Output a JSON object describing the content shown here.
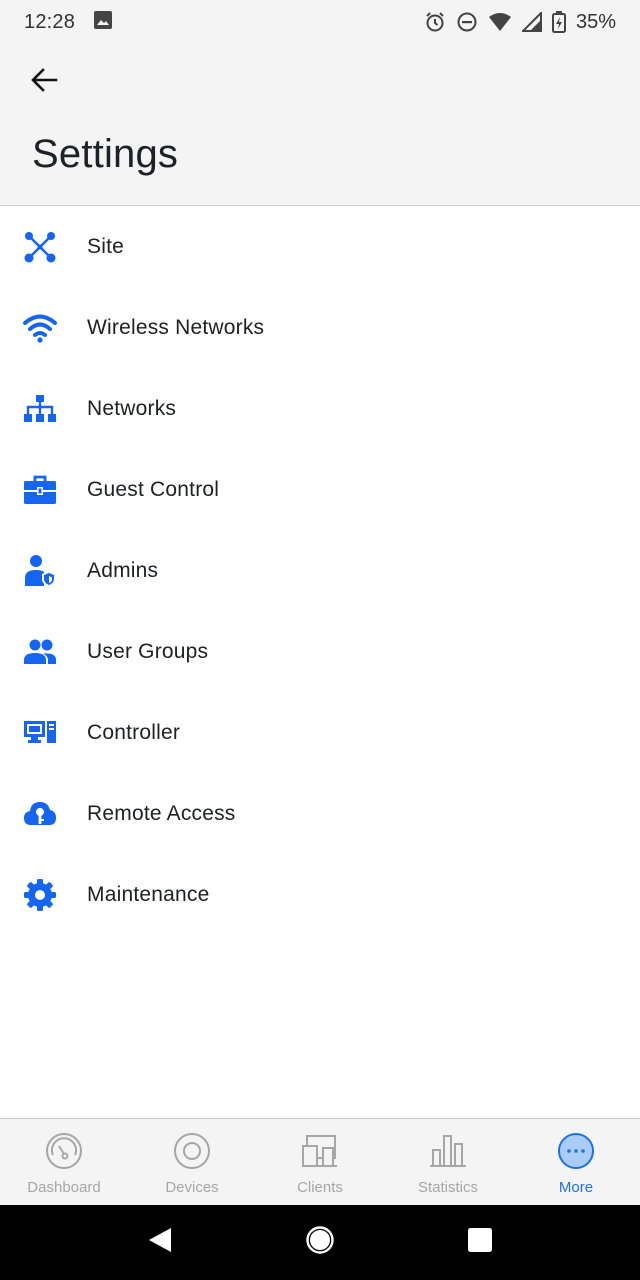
{
  "status_bar": {
    "time": "12:28",
    "battery": "35%",
    "icons": [
      "image-icon",
      "alarm-icon",
      "dnd-icon",
      "wifi-icon",
      "cell-signal-icon",
      "battery-icon"
    ]
  },
  "header": {
    "title": "Settings",
    "back_icon": "arrow-left-icon"
  },
  "menu": {
    "items": [
      {
        "label": "Site",
        "icon": "site-nodes-icon"
      },
      {
        "label": "Wireless Networks",
        "icon": "wifi-icon"
      },
      {
        "label": "Networks",
        "icon": "network-tree-icon"
      },
      {
        "label": "Guest Control",
        "icon": "briefcase-icon"
      },
      {
        "label": "Admins",
        "icon": "admin-shield-icon"
      },
      {
        "label": "User Groups",
        "icon": "user-group-icon"
      },
      {
        "label": "Controller",
        "icon": "controller-icon"
      },
      {
        "label": "Remote Access",
        "icon": "cloud-key-icon"
      },
      {
        "label": "Maintenance",
        "icon": "gear-icon"
      }
    ]
  },
  "bottom_nav": {
    "tabs": [
      {
        "label": "Dashboard",
        "icon": "dashboard-gauge-icon",
        "active": false
      },
      {
        "label": "Devices",
        "icon": "devices-circle-icon",
        "active": false
      },
      {
        "label": "Clients",
        "icon": "clients-icon",
        "active": false
      },
      {
        "label": "Statistics",
        "icon": "bar-chart-icon",
        "active": false
      },
      {
        "label": "More",
        "icon": "more-dots-icon",
        "active": true
      }
    ]
  },
  "colors": {
    "accent": "#1a73e8",
    "icon_blue": "#1565f0",
    "inactive": "#a6a6a6",
    "bar_bg": "#f4f4f4"
  }
}
